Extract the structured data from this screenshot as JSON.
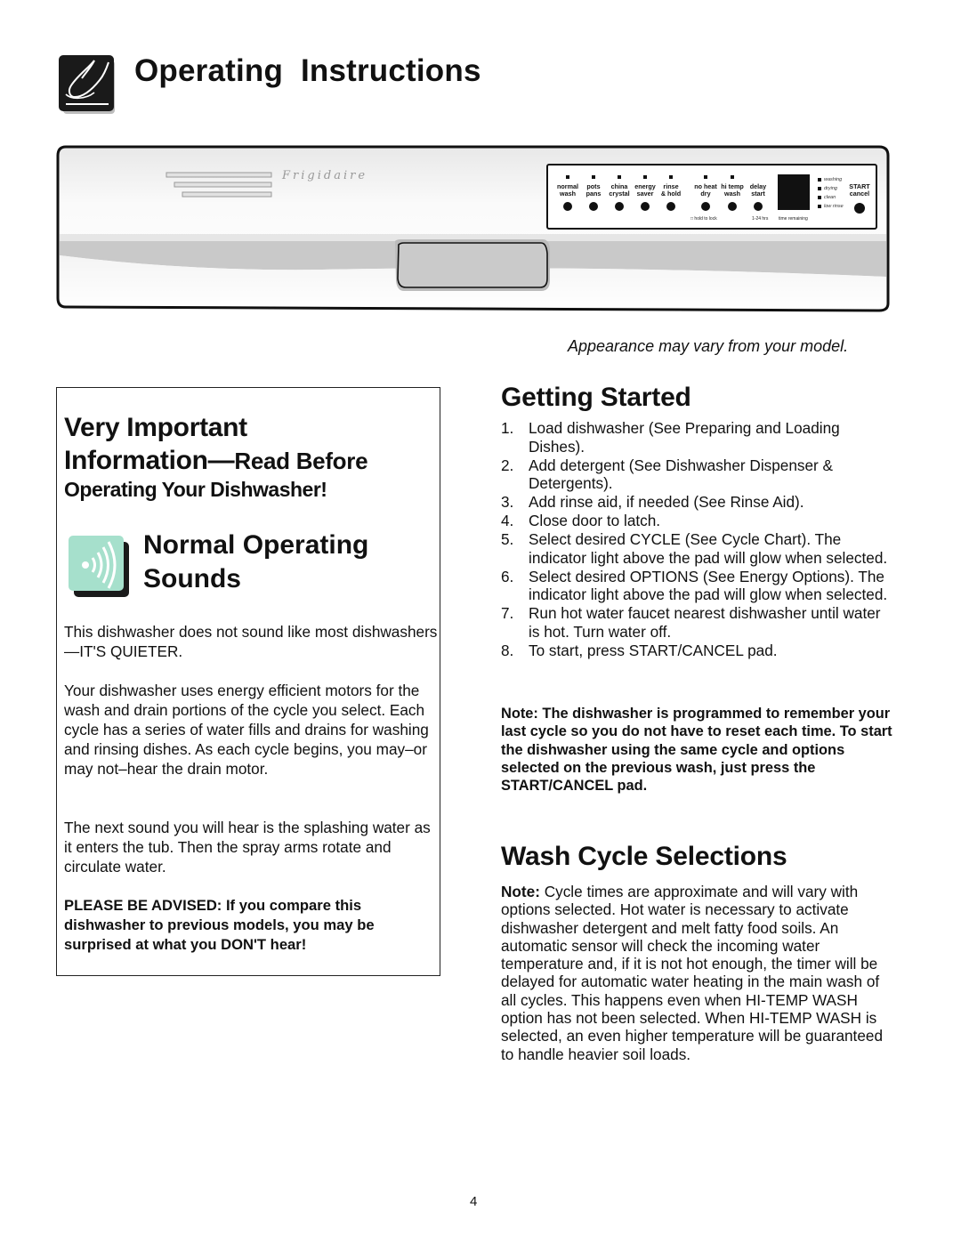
{
  "header": {
    "title": "Operating  Instructions",
    "icon": "finger-touch-icon"
  },
  "control_panel": {
    "brand": "Frigidaire",
    "buttons": [
      {
        "label": "normal\nwash"
      },
      {
        "label": "pots\npans"
      },
      {
        "label": "china\ncrystal"
      },
      {
        "label": "energy\nsaver"
      },
      {
        "label": "rinse\n& hold"
      },
      {
        "label": "no heat\ndry"
      },
      {
        "label": "hi temp\nwash"
      },
      {
        "label": "delay\nstart"
      }
    ],
    "hold_to_lock": "hold to lock",
    "delay_range": "1-24 hrs",
    "time_remaining": "time remaining",
    "status_lights": [
      "washing",
      "drying",
      "clean",
      "low rinse"
    ],
    "start_label": "START\ncancel"
  },
  "caption": "Appearance may vary from your model.",
  "info_box": {
    "heading_line1": "Very Important",
    "heading_line2_main": "Information—",
    "heading_line2_small": "Read Before",
    "heading_line3": "Operating Your Dishwasher!",
    "sounds_icon": "sound-waves-icon",
    "sounds_title": "Normal Operating Sounds",
    "paragraphs": [
      "This dishwasher does not sound like most dishwashers—IT'S  QUIETER.",
      "Your dishwasher uses energy efficient motors for the wash and drain portions of the cycle you select. Each cycle has a series of water fills and drains for washing and rinsing dishes. As each cycle begins, you may–or may not–hear the drain motor.",
      "The next sound you will hear is the splashing water as it enters the tub. Then the spray arms rotate and circulate water.",
      "PLEASE BE ADVISED: If you compare this dishwasher to previous models, you may be surprised at what you DON'T hear!"
    ]
  },
  "getting_started": {
    "title": "Getting Started",
    "steps": [
      {
        "num": "1.",
        "text": "Load dishwasher (See Preparing and Loading Dishes)."
      },
      {
        "num": "2.",
        "text": "Add detergent (See Dishwasher Dispenser & Detergents)."
      },
      {
        "num": "3.",
        "text": "Add rinse aid, if needed (See Rinse Aid)."
      },
      {
        "num": "4.",
        "text": "Close door to latch."
      },
      {
        "num": "5.",
        "text": "Select desired CYCLE (See Cycle Chart). The indicator light above the pad will glow when selected."
      },
      {
        "num": "6.",
        "text": "Select desired OPTIONS (See Energy Options). The indicator light above the pad will glow when selected."
      },
      {
        "num": "7.",
        "text": "Run hot water faucet nearest dishwasher until water is hot. Turn water off."
      },
      {
        "num": "8.",
        "text": "To start, press START/CANCEL pad."
      }
    ],
    "note": "Note: The dishwasher is programmed to remember your last cycle so you do not have to reset each time. To start the dishwasher using the same cycle and options selected on the previous wash, just press the START/CANCEL pad."
  },
  "wash_cycle": {
    "title": "Wash Cycle Selections",
    "note_label": "Note:",
    "note_text": " Cycle times are approximate and will vary with options selected. Hot water is necessary to activate dishwasher detergent and melt fatty food soils. An automatic sensor will check the incoming water temperature and, if it is not hot enough, the timer will be delayed for automatic water heating in the main wash of all cycles. This happens even when HI-TEMP WASH option has not been selected. When HI-TEMP WASH is selected, an even higher temperature will be guaranteed to handle heavier soil loads."
  },
  "page_number": "4",
  "colors": {
    "sound_icon_fill": "#a6e0cc",
    "panel_gray": "#c9c9c9"
  }
}
